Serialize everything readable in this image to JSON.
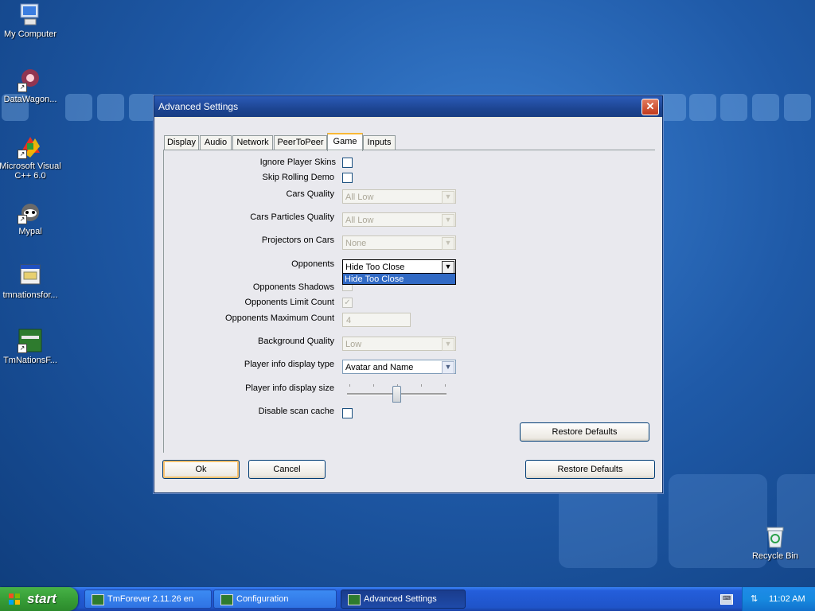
{
  "desktop": {
    "icons": [
      {
        "label": "My Computer"
      },
      {
        "label": "DataWagon..."
      },
      {
        "label": "Microsoft Visual C++ 6.0"
      },
      {
        "label": "Mypal"
      },
      {
        "label": "tmnationsfor..."
      },
      {
        "label": "TmNationsF..."
      },
      {
        "label": "Recycle Bin"
      }
    ]
  },
  "dialog": {
    "title": "Advanced Settings",
    "tabs": [
      {
        "label": "Display"
      },
      {
        "label": "Audio"
      },
      {
        "label": "Network"
      },
      {
        "label": "PeerToPeer"
      },
      {
        "label": "Game"
      },
      {
        "label": "Inputs"
      }
    ],
    "active_tab": "Game",
    "settings": {
      "ignore_player_skins": "Ignore Player Skins",
      "skip_rolling_demo": "Skip Rolling Demo",
      "cars_quality": {
        "label": "Cars Quality",
        "value": "All Low"
      },
      "cars_particles_quality": {
        "label": "Cars Particles Quality",
        "value": "All Low"
      },
      "projectors_on_cars": {
        "label": "Projectors on Cars",
        "value": "None"
      },
      "opponents": {
        "label": "Opponents",
        "value": "Hide Too Close",
        "dropdown_option": "Hide Too Close"
      },
      "opponents_shadows": "Opponents Shadows",
      "opponents_limit_count": {
        "label": "Opponents Limit Count",
        "check": "✓"
      },
      "opponents_maximum_count": {
        "label": "Opponents Maximum Count",
        "value": "4"
      },
      "background_quality": {
        "label": "Background Quality",
        "value": "Low"
      },
      "player_info_display_type": {
        "label": "Player info display type",
        "value": "Avatar and Name"
      },
      "player_info_display_size": {
        "label": "Player info display size",
        "slider_fraction": 0.5
      },
      "disable_scan_cache": "Disable scan cache"
    },
    "panel_restore_label": "Restore Defaults",
    "ok_label": "Ok",
    "cancel_label": "Cancel",
    "restore_label": "Restore Defaults"
  },
  "taskbar": {
    "start_label": "start",
    "tasks": [
      {
        "label": "TmForever 2.11.26 en"
      },
      {
        "label": "Configuration"
      },
      {
        "label": "Advanced Settings"
      }
    ],
    "clock": "11:02 AM"
  },
  "colors": {
    "selection": "#316ac5",
    "titlebar": "#1d4592",
    "close": "#c0391b"
  }
}
